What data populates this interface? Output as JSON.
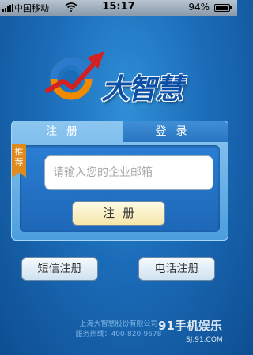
{
  "status_bar": {
    "carrier": "中国移动",
    "time": "15:17",
    "battery": "94%"
  },
  "logo": {
    "text": "大智慧"
  },
  "tabs": {
    "register": "注册",
    "login": "登录"
  },
  "form": {
    "badge": "推荐",
    "email_placeholder": "请输入您的企业邮箱",
    "register_label": "注册"
  },
  "alt_buttons": {
    "sms": "短信注册",
    "phone": "电话注册"
  },
  "footer": {
    "line1": "上海大智慧股份有限公司",
    "line2": "服务热线：400-820-9678",
    "watermark": "91手机娱乐",
    "watermark_url": "SJ.91.COM"
  },
  "colors": {
    "background": "#1b6cb8",
    "accent": "#e08a1e",
    "primary_button": "#f5e6a8"
  }
}
